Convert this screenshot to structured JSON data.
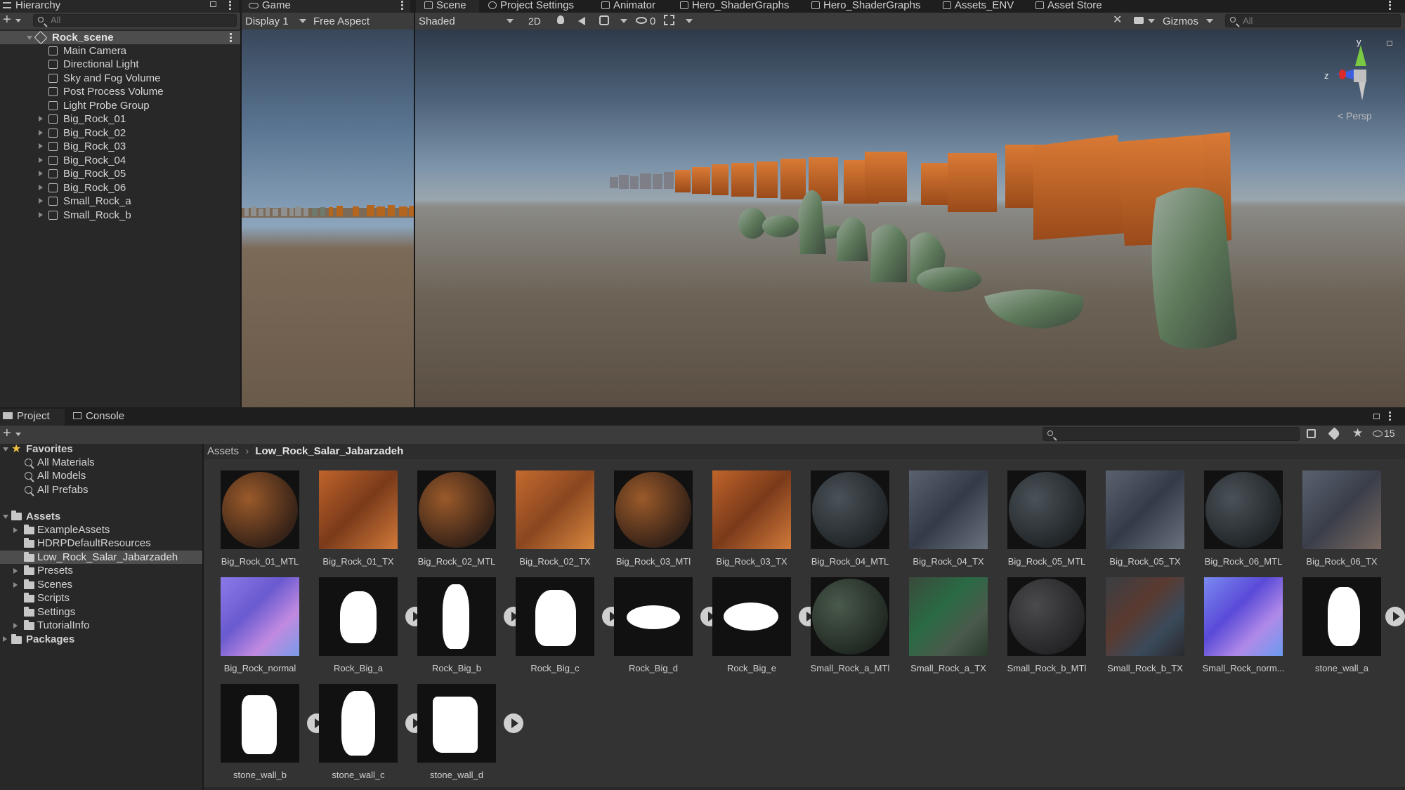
{
  "hierarchy": {
    "tab": "Hierarchy",
    "search_placeholder": "All",
    "scene": "Rock_scene",
    "items": [
      "Main Camera",
      "Directional Light",
      "Sky and Fog Volume",
      "Post Process Volume",
      "Light Probe Group",
      "Big_Rock_01",
      "Big_Rock_02",
      "Big_Rock_03",
      "Big_Rock_04",
      "Big_Rock_05",
      "Big_Rock_06",
      "Small_Rock_a",
      "Small_Rock_b"
    ]
  },
  "game": {
    "tab": "Game",
    "display": "Display 1",
    "aspect": "Free Aspect"
  },
  "scene_tabs": [
    "Scene",
    "Project Settings",
    "Animator",
    "Hero_ShaderGraphs",
    "Hero_ShaderGraphs",
    "Assets_ENV",
    "Asset Store"
  ],
  "scene_toolbar": {
    "shading": "Shaded",
    "mode_2d": "2D",
    "hidden_count": "0",
    "gizmos": "Gizmos",
    "search_placeholder": "All",
    "persp": "< Persp",
    "axis_y": "y",
    "axis_z": "z"
  },
  "bottom_tabs": [
    "Project",
    "Console"
  ],
  "project": {
    "hidden_count": "15",
    "favorites_label": "Favorites",
    "favorites": [
      "All Materials",
      "All Models",
      "All Prefabs"
    ],
    "assets_label": "Assets",
    "folders": [
      "ExampleAssets",
      "HDRPDefaultResources",
      "Low_Rock_Salar_Jabarzadeh",
      "Presets",
      "Scenes",
      "Scripts",
      "Settings",
      "TutorialInfo"
    ],
    "packages_label": "Packages",
    "breadcrumb": [
      "Assets",
      "Low_Rock_Salar_Jabarzadeh"
    ],
    "assets": [
      "Big_Rock_01_MTL",
      "Big_Rock_01_TX",
      "Big_Rock_02_MTL",
      "Big_Rock_02_TX",
      "Big_Rock_03_MTl",
      "Big_Rock_03_TX",
      "Big_Rock_04_MTL",
      "Big_Rock_04_TX",
      "Big_Rock_05_MTL",
      "Big_Rock_05_TX",
      "Big_Rock_06_MTL",
      "Big_Rock_06_TX",
      "Big_Rock_normal",
      "Rock_Big_a",
      "Rock_Big_b",
      "Rock_Big_c",
      "Rock_Big_d",
      "Rock_Big_e",
      "Small_Rock_a_MTl",
      "Small_Rock_a_TX",
      "Small_Rock_b_MTl",
      "Small_Rock_b_TX",
      "Small_Rock_norm...",
      "stone_wall_a",
      "stone_wall_b",
      "stone_wall_c",
      "stone_wall_d"
    ]
  },
  "colors": {
    "selected": "#4d4d4d",
    "panel": "#282828",
    "toolbar": "#3c3c3c",
    "accent": "#3a79bb"
  }
}
